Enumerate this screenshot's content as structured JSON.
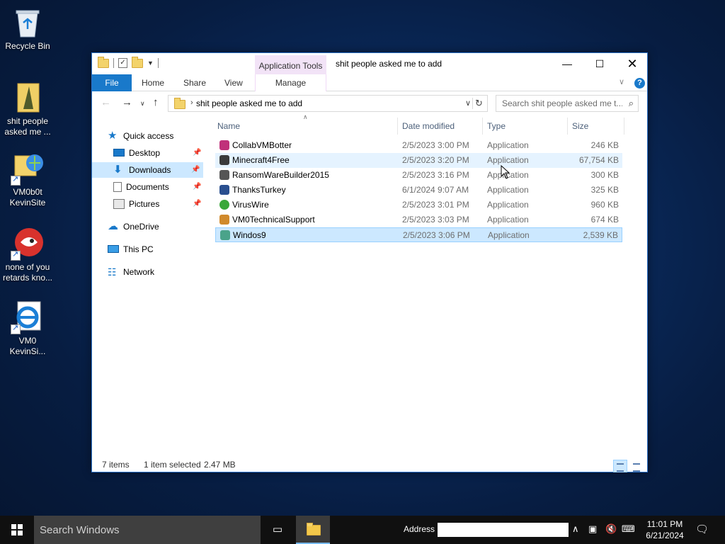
{
  "desktop": {
    "icons": [
      {
        "label": "Recycle Bin",
        "icon": "recycle-bin-icon"
      },
      {
        "label": "shit people asked me ...",
        "icon": "folder-icon"
      },
      {
        "label": "VM0b0t KevinSite",
        "icon": "shortcut-icon"
      },
      {
        "label": "none of you retards kno...",
        "icon": "shortcut-icon"
      },
      {
        "label": "VM0 KevinSi...",
        "icon": "internet-explorer-icon"
      }
    ]
  },
  "window": {
    "title": "shit people asked me to add",
    "context_tab_group": "Application Tools",
    "ribbon_tabs": [
      "File",
      "Home",
      "Share",
      "View",
      "Manage"
    ],
    "address_path": "shit people asked me to add",
    "search_placeholder": "Search shit people asked me t..."
  },
  "nav_pane": {
    "items": [
      {
        "label": "Quick access",
        "icon": "star-icon",
        "pinned": false
      },
      {
        "label": "Desktop",
        "icon": "desktop-icon",
        "pinned": true
      },
      {
        "label": "Downloads",
        "icon": "downloads-icon",
        "pinned": true,
        "selected": true
      },
      {
        "label": "Documents",
        "icon": "documents-icon",
        "pinned": true
      },
      {
        "label": "Pictures",
        "icon": "pictures-icon",
        "pinned": true
      },
      {
        "label": "OneDrive",
        "icon": "onedrive-icon",
        "pinned": false
      },
      {
        "label": "This PC",
        "icon": "this-pc-icon",
        "pinned": false
      },
      {
        "label": "Network",
        "icon": "network-icon",
        "pinned": false
      }
    ]
  },
  "file_list": {
    "columns": [
      "Name",
      "Date modified",
      "Type",
      "Size"
    ],
    "rows": [
      {
        "name": "CollabVMBotter",
        "date": "2/5/2023 3:00 PM",
        "type": "Application",
        "size": "246 KB",
        "color": "#c0317a"
      },
      {
        "name": "Minecraft4Free",
        "date": "2/5/2023 3:20 PM",
        "type": "Application",
        "size": "67,754 KB",
        "color": "#3b3b3b"
      },
      {
        "name": "RansomWareBuilder2015",
        "date": "2/5/2023 3:16 PM",
        "type": "Application",
        "size": "300 KB",
        "color": "#555555"
      },
      {
        "name": "ThanksTurkey",
        "date": "6/1/2024 9:07 AM",
        "type": "Application",
        "size": "325 KB",
        "color": "#2a4f8f"
      },
      {
        "name": "VirusWire",
        "date": "2/5/2023 3:01 PM",
        "type": "Application",
        "size": "960 KB",
        "color": "#3aa73a"
      },
      {
        "name": "VM0TechnicalSupport",
        "date": "2/5/2023 3:03 PM",
        "type": "Application",
        "size": "674 KB",
        "color": "#d08a2c"
      },
      {
        "name": "Windos9",
        "date": "2/5/2023 3:06 PM",
        "type": "Application",
        "size": "2,539 KB",
        "color": "#4aa38a"
      }
    ]
  },
  "status": {
    "item_count": "7 items",
    "selection": "1 item selected",
    "selection_size": "2.47 MB"
  },
  "taskbar": {
    "search_placeholder": "Search Windows",
    "address_label": "Address",
    "time": "11:01 PM",
    "date": "6/21/2024"
  },
  "colors": {
    "accent": "#1979ca",
    "selection": "#cce8ff",
    "context_tab": "#f2e3f7"
  }
}
